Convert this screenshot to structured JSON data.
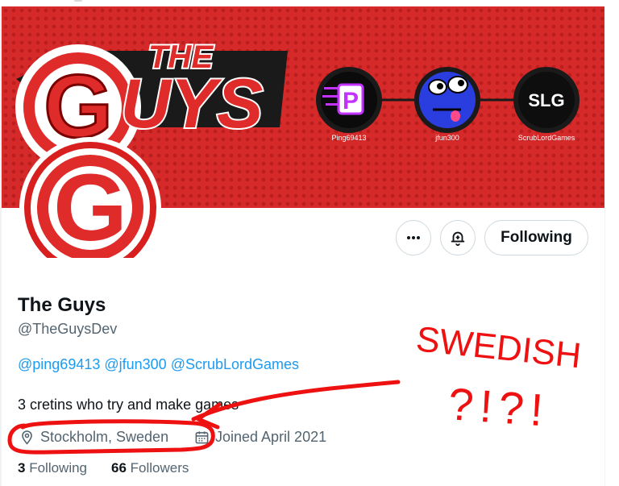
{
  "banner": {
    "title_small": "THE",
    "title_letter": "G",
    "title_rest": "UYS",
    "members": [
      {
        "initial": "P",
        "label": "Ping69413"
      },
      {
        "initial": "",
        "label": "jfun300"
      },
      {
        "initial": "SLG",
        "label": "ScrubLordGames"
      }
    ],
    "colors": {
      "background": "#d62a2a",
      "logo_red": "#e02b2b",
      "dark": "#1a1a1a"
    }
  },
  "avatar": {
    "letter": "G"
  },
  "actions": {
    "more_icon": "more-horizontal-icon",
    "notify_icon": "bell-plus-icon",
    "following_label": "Following"
  },
  "profile": {
    "name": "The Guys",
    "handle": "@TheGuysDev",
    "bio_mentions": [
      "@ping69413",
      "@jfun300",
      "@ScrubLordGames"
    ],
    "bio_text": "3 cretins who try and make games",
    "location": "Stockholm, Sweden",
    "joined": "Joined April 2021",
    "following_count": "3",
    "following_label": "Following",
    "followers_count": "66",
    "followers_label": "Followers"
  },
  "annotation": {
    "line1": "SWEDISH",
    "line2": "?!?!",
    "color": "#ee1111"
  },
  "colors": {
    "link": "#1d9bf0",
    "muted": "#536471",
    "text": "#0f1419",
    "border": "#cfd9de"
  }
}
